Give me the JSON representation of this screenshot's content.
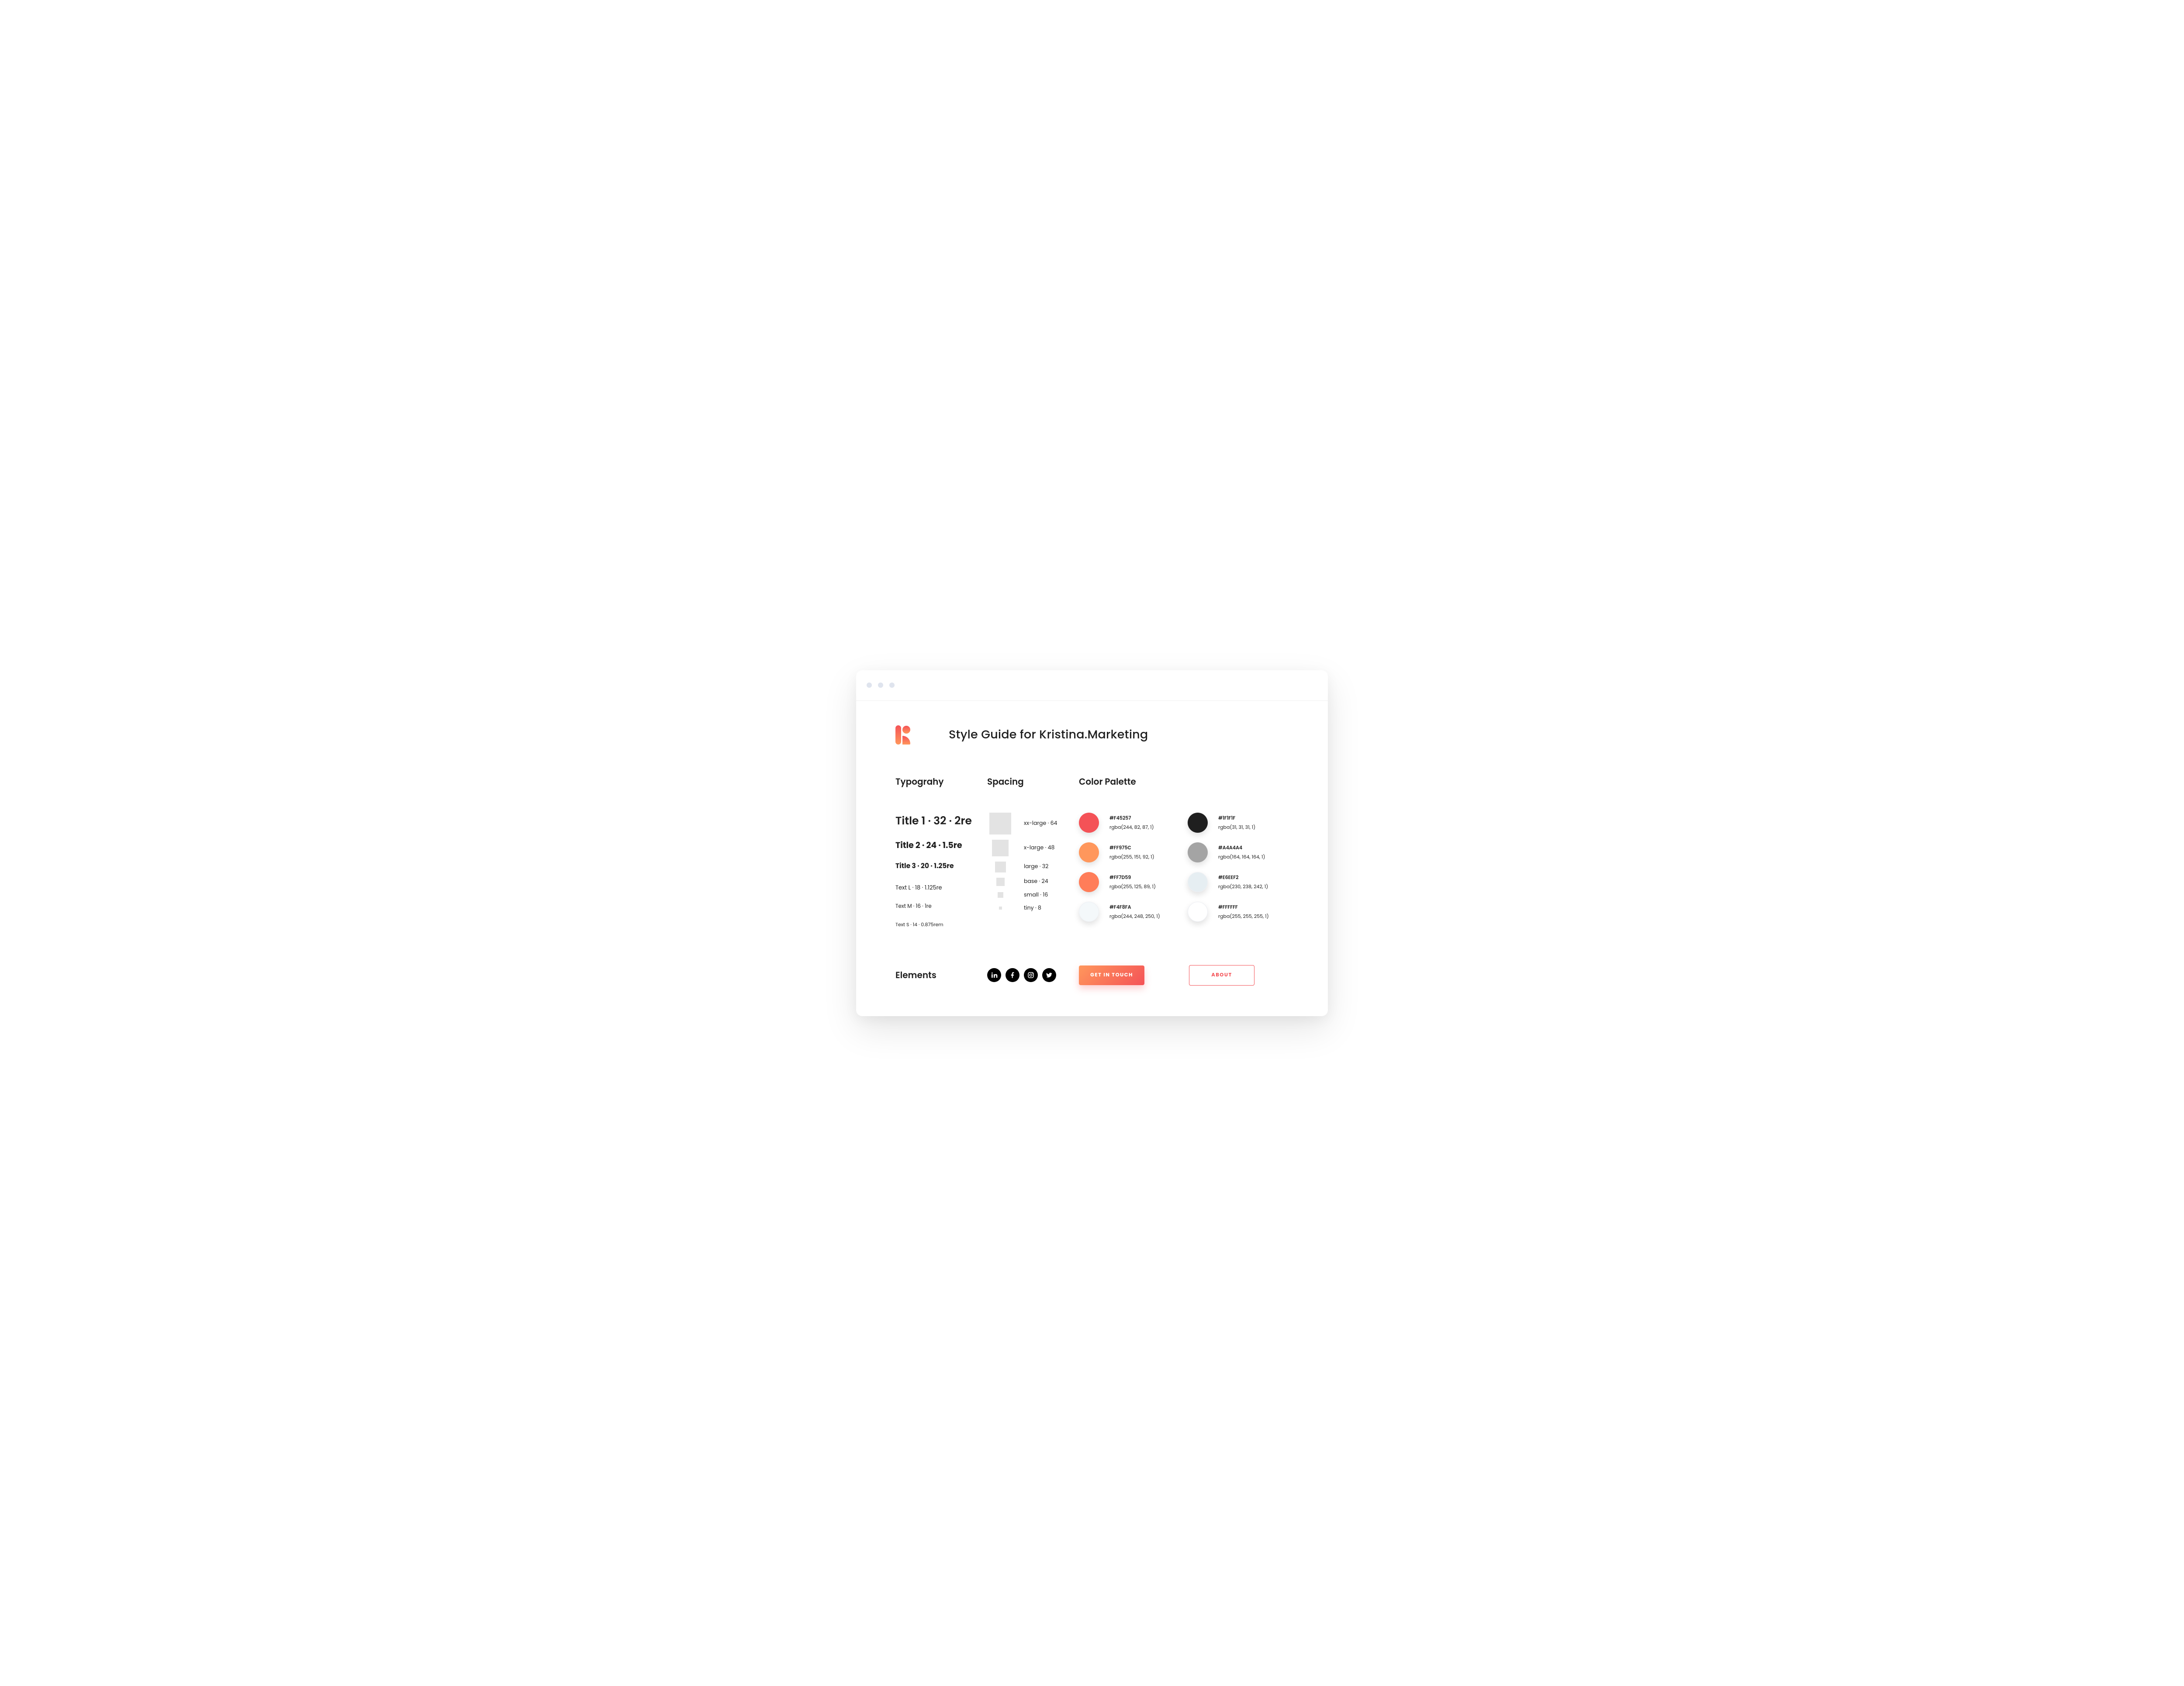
{
  "page_title": "Style Guide for Kristina.Marketing",
  "sections": {
    "typography_heading": "Typograhy",
    "spacing_heading": "Spacing",
    "palette_heading": "Color Palette",
    "elements_heading": "Elements"
  },
  "typography": [
    {
      "label": "Title 1 · 32 · 2re"
    },
    {
      "label": "Title 2 · 24 · 1.5re"
    },
    {
      "label": "Title 3 · 20 · 1.25re"
    },
    {
      "label": "Text L · 18 · 1.125re"
    },
    {
      "label": "Text M · 16 · 1re"
    },
    {
      "label": "Text S · 14 · 0.875rem"
    }
  ],
  "spacing": [
    {
      "label": "xx-large · 64",
      "px": 50
    },
    {
      "label": "x-large · 48",
      "px": 38
    },
    {
      "label": "large · 32",
      "px": 25
    },
    {
      "label": "base · 24",
      "px": 19
    },
    {
      "label": "small · 16",
      "px": 13
    },
    {
      "label": "tiny · 8",
      "px": 7
    }
  ],
  "palette": [
    {
      "hex": "#F45257",
      "rgba": "rgba(244, 82, 87, 1)"
    },
    {
      "hex": "#1F1F1F",
      "rgba": "rgba(31, 31, 31, 1)"
    },
    {
      "hex": "#FF975C",
      "rgba": "rgba(255, 151, 92, 1)"
    },
    {
      "hex": "#A4A4A4",
      "rgba": "rgba(164, 164, 164, 1)"
    },
    {
      "hex": "#FF7D59",
      "rgba": "rgba(255, 125, 89, 1)"
    },
    {
      "hex": "#E6EEF2",
      "rgba": "rgba(230, 238, 242, 1)"
    },
    {
      "hex": "#F4F8FA",
      "rgba": "rgba(244, 248, 250, 1)"
    },
    {
      "hex": "#FFFFFF",
      "rgba": "rgba(255, 255, 255, 1)"
    }
  ],
  "buttons": {
    "primary": "GET IN TOUCH",
    "secondary": "ABOUT"
  },
  "social": [
    "linkedin",
    "facebook",
    "instagram",
    "twitter"
  ]
}
